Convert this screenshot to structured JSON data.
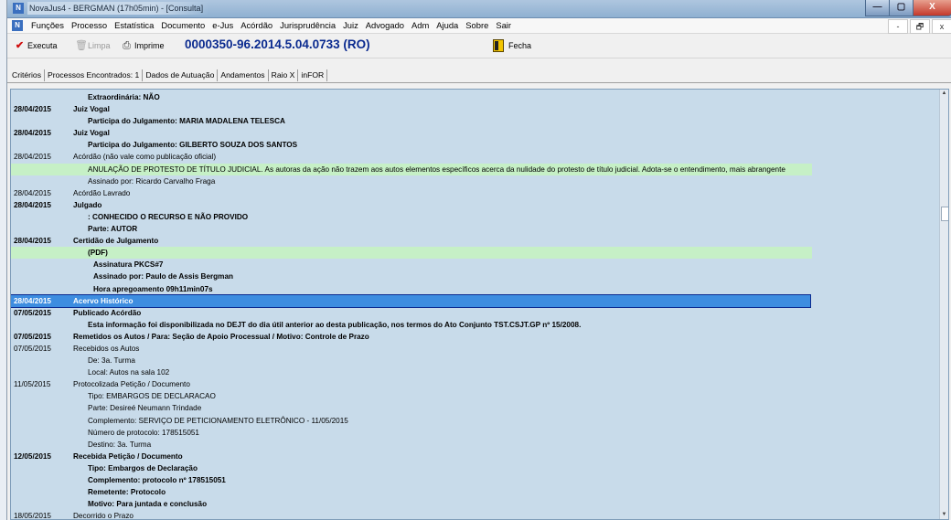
{
  "window": {
    "title": "NovaJus4 - BERGMAN (17h05min) - [Consulta]",
    "min": "—",
    "max": "▢",
    "close": "X"
  },
  "menu": [
    "Funções",
    "Processo",
    "Estatística",
    "Documento",
    "e-Jus",
    "Acórdão",
    "Jurisprudência",
    "Juiz",
    "Advogado",
    "Adm",
    "Ajuda",
    "Sobre",
    "Sair"
  ],
  "mdi": {
    "min": "-",
    "restore": "🗗",
    "close": "x"
  },
  "toolbar": {
    "execute": "Executa",
    "clear": "Limpa",
    "print": "Imprime",
    "process_number": "0000350-96.2014.5.04.0733 (RO)",
    "close": "Fecha"
  },
  "tabs": [
    "Critérios",
    "Processos Encontrados: 1",
    "Dados de Autuação",
    "Andamentos",
    "Raio X",
    "inFOR"
  ],
  "rows": [
    {
      "date": "",
      "text": "Extraordinária: NÃO",
      "bold": true,
      "indent": 1
    },
    {
      "date": "28/04/2015",
      "text": "Juiz Vogal",
      "bold": true,
      "indent": 0
    },
    {
      "date": "",
      "text": "Participa do Julgamento: MARIA MADALENA TELESCA",
      "bold": true,
      "indent": 1
    },
    {
      "date": "28/04/2015",
      "text": "Juiz Vogal",
      "bold": true,
      "indent": 0
    },
    {
      "date": "",
      "text": "Participa do Julgamento: GILBERTO SOUZA DOS SANTOS",
      "bold": true,
      "indent": 1
    },
    {
      "date": "28/04/2015",
      "text": "Acórdão (não vale como publicação oficial)",
      "bold": false,
      "indent": 0
    },
    {
      "date": "",
      "text": "ANULAÇÃO DE PROTESTO DE TÍTULO JUDICIAL. As autoras da ação não trazem aos autos elementos específicos acerca da nulidade do protesto de título judicial. Adota-se o entendimento, mais abrangente",
      "bold": false,
      "indent": 1,
      "hl": "green"
    },
    {
      "date": "",
      "text": "Assinado por: Ricardo Carvalho Fraga",
      "bold": false,
      "indent": 1
    },
    {
      "date": "28/04/2015",
      "text": "Acórdão Lavrado",
      "bold": false,
      "indent": 0
    },
    {
      "date": "28/04/2015",
      "text": "Julgado",
      "bold": true,
      "indent": 0
    },
    {
      "date": "",
      "text": ": CONHECIDO O RECURSO E NÃO PROVIDO",
      "bold": true,
      "indent": 1
    },
    {
      "date": "",
      "text": "Parte: AUTOR",
      "bold": true,
      "indent": 1
    },
    {
      "date": "28/04/2015",
      "text": "Certidão de Julgamento",
      "bold": true,
      "indent": 0
    },
    {
      "date": "",
      "text": "(PDF)",
      "bold": true,
      "indent": 1,
      "hl": "green"
    },
    {
      "date": "",
      "text": "Assinatura PKCS#7",
      "bold": true,
      "indent": 2
    },
    {
      "date": "",
      "text": "Assinado por: Paulo de Assis Bergman",
      "bold": true,
      "indent": 2
    },
    {
      "date": "",
      "text": "Hora apregoamento 09h11min07s",
      "bold": true,
      "indent": 2
    },
    {
      "date": "28/04/2015",
      "text": "Acervo Histórico",
      "bold": true,
      "indent": 0,
      "selected": true
    },
    {
      "date": "07/05/2015",
      "text": "Publicado Acórdão",
      "bold": true,
      "indent": 0
    },
    {
      "date": "",
      "text": "Esta informação foi disponibilizada no DEJT do dia útil anterior ao desta publicação, nos termos do Ato Conjunto TST.CSJT.GP nº 15/2008.",
      "bold": true,
      "indent": 1
    },
    {
      "date": "07/05/2015",
      "text": "Remetidos os Autos / Para: Seção de Apoio Processual / Motivo: Controle de Prazo",
      "bold": true,
      "indent": 0
    },
    {
      "date": "07/05/2015",
      "text": "Recebidos os Autos",
      "bold": false,
      "indent": 0
    },
    {
      "date": "",
      "text": "De: 3a. Turma",
      "bold": false,
      "indent": 1
    },
    {
      "date": "",
      "text": "Local: Autos na sala 102",
      "bold": false,
      "indent": 1
    },
    {
      "date": "11/05/2015",
      "text": "Protocolizada Petição / Documento",
      "bold": false,
      "indent": 0
    },
    {
      "date": "",
      "text": "Tipo: EMBARGOS DE DECLARACAO",
      "bold": false,
      "indent": 1
    },
    {
      "date": "",
      "text": "Parte: Desireé Neumann Trindade",
      "bold": false,
      "indent": 1
    },
    {
      "date": "",
      "text": "Complemento: SERVIÇO DE PETICIONAMENTO ELETRÔNICO - 11/05/2015",
      "bold": false,
      "indent": 1
    },
    {
      "date": "",
      "text": "Número de protocolo: 178515051",
      "bold": false,
      "indent": 1
    },
    {
      "date": "",
      "text": "Destino: 3a. Turma",
      "bold": false,
      "indent": 1
    },
    {
      "date": "12/05/2015",
      "text": "Recebida Petição / Documento",
      "bold": true,
      "indent": 0
    },
    {
      "date": "",
      "text": "Tipo: Embargos de Declaração",
      "bold": true,
      "indent": 1
    },
    {
      "date": "",
      "text": "Complemento: protocolo nº 178515051",
      "bold": true,
      "indent": 1
    },
    {
      "date": "",
      "text": "Remetente: Protocolo",
      "bold": true,
      "indent": 1
    },
    {
      "date": "",
      "text": "Motivo: Para juntada e conclusão",
      "bold": true,
      "indent": 1
    },
    {
      "date": "18/05/2015",
      "text": "Decorrido o Prazo",
      "bold": false,
      "indent": 0
    }
  ]
}
